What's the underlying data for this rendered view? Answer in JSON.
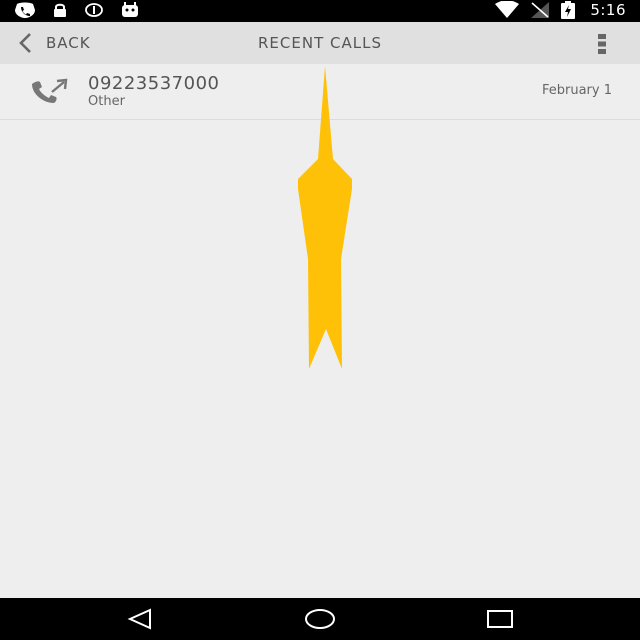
{
  "status_bar": {
    "time": "5:16",
    "left_icons": [
      "call-notification-icon",
      "lock-icon",
      "info-icon",
      "android-icon"
    ],
    "right_icons": [
      "wifi-icon",
      "no-signal-icon",
      "battery-charging-icon"
    ]
  },
  "app_bar": {
    "back_label": "BACK",
    "title": "RECENT CALLS",
    "menu_icon": "overflow-menu-icon"
  },
  "calls": [
    {
      "number": "09223537000",
      "type": "Other",
      "date": "February 1",
      "icon": "outgoing-call-icon"
    }
  ],
  "nav_bar": {
    "buttons": [
      "back-triangle-icon",
      "home-circle-icon",
      "recents-square-icon"
    ]
  },
  "colors": {
    "background": "#eeeeee",
    "app_bar": "#e0e0e0",
    "text": "#555555",
    "pointer": "#ffc107"
  }
}
